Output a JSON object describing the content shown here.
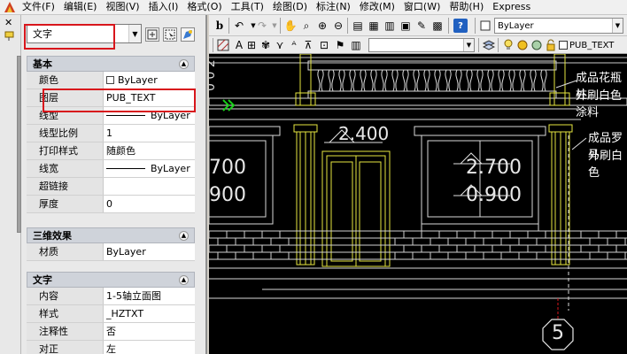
{
  "menu": {
    "items": [
      "文件(F)",
      "编辑(E)",
      "视图(V)",
      "插入(I)",
      "格式(O)",
      "工具(T)",
      "绘图(D)",
      "标注(N)",
      "修改(M)",
      "窗口(W)",
      "帮助(H)",
      "Express"
    ]
  },
  "palette": {
    "selection": "文字",
    "sections": {
      "basic": "基本",
      "3d": "三维效果",
      "text": "文字"
    },
    "basic_rows": [
      {
        "label": "颜色",
        "value": "ByLayer"
      },
      {
        "label": "图层",
        "value": "PUB_TEXT"
      },
      {
        "label": "线型",
        "value": "ByLayer"
      },
      {
        "label": "线型比例",
        "value": "1"
      },
      {
        "label": "打印样式",
        "value": "随颜色"
      },
      {
        "label": "线宽",
        "value": "ByLayer"
      },
      {
        "label": "超链接",
        "value": ""
      },
      {
        "label": "厚度",
        "value": "0"
      }
    ],
    "3d_rows": [
      {
        "label": "材质",
        "value": "ByLayer"
      }
    ],
    "text_rows": [
      {
        "label": "内容",
        "value": "1-5轴立面图"
      },
      {
        "label": "样式",
        "value": "_HZTXT"
      },
      {
        "label": "注释性",
        "value": "否"
      },
      {
        "label": "对正",
        "value": "左"
      }
    ]
  },
  "toolbar": {
    "layer_combo": "ByLayer",
    "layer_name": "PUB_TEXT"
  },
  "drawing": {
    "dims": [
      "2.400",
      "2.700",
      "0.900",
      "700",
      "900",
      "2.400"
    ],
    "notes": [
      "成品花瓶柱",
      "外刷白色涂料",
      "成品罗马",
      "外刷白色"
    ],
    "axis_label": "5"
  },
  "colors": {
    "highlight": "#d8161c",
    "yellow_lines": "#e6e640",
    "green_grip": "#18d018"
  }
}
